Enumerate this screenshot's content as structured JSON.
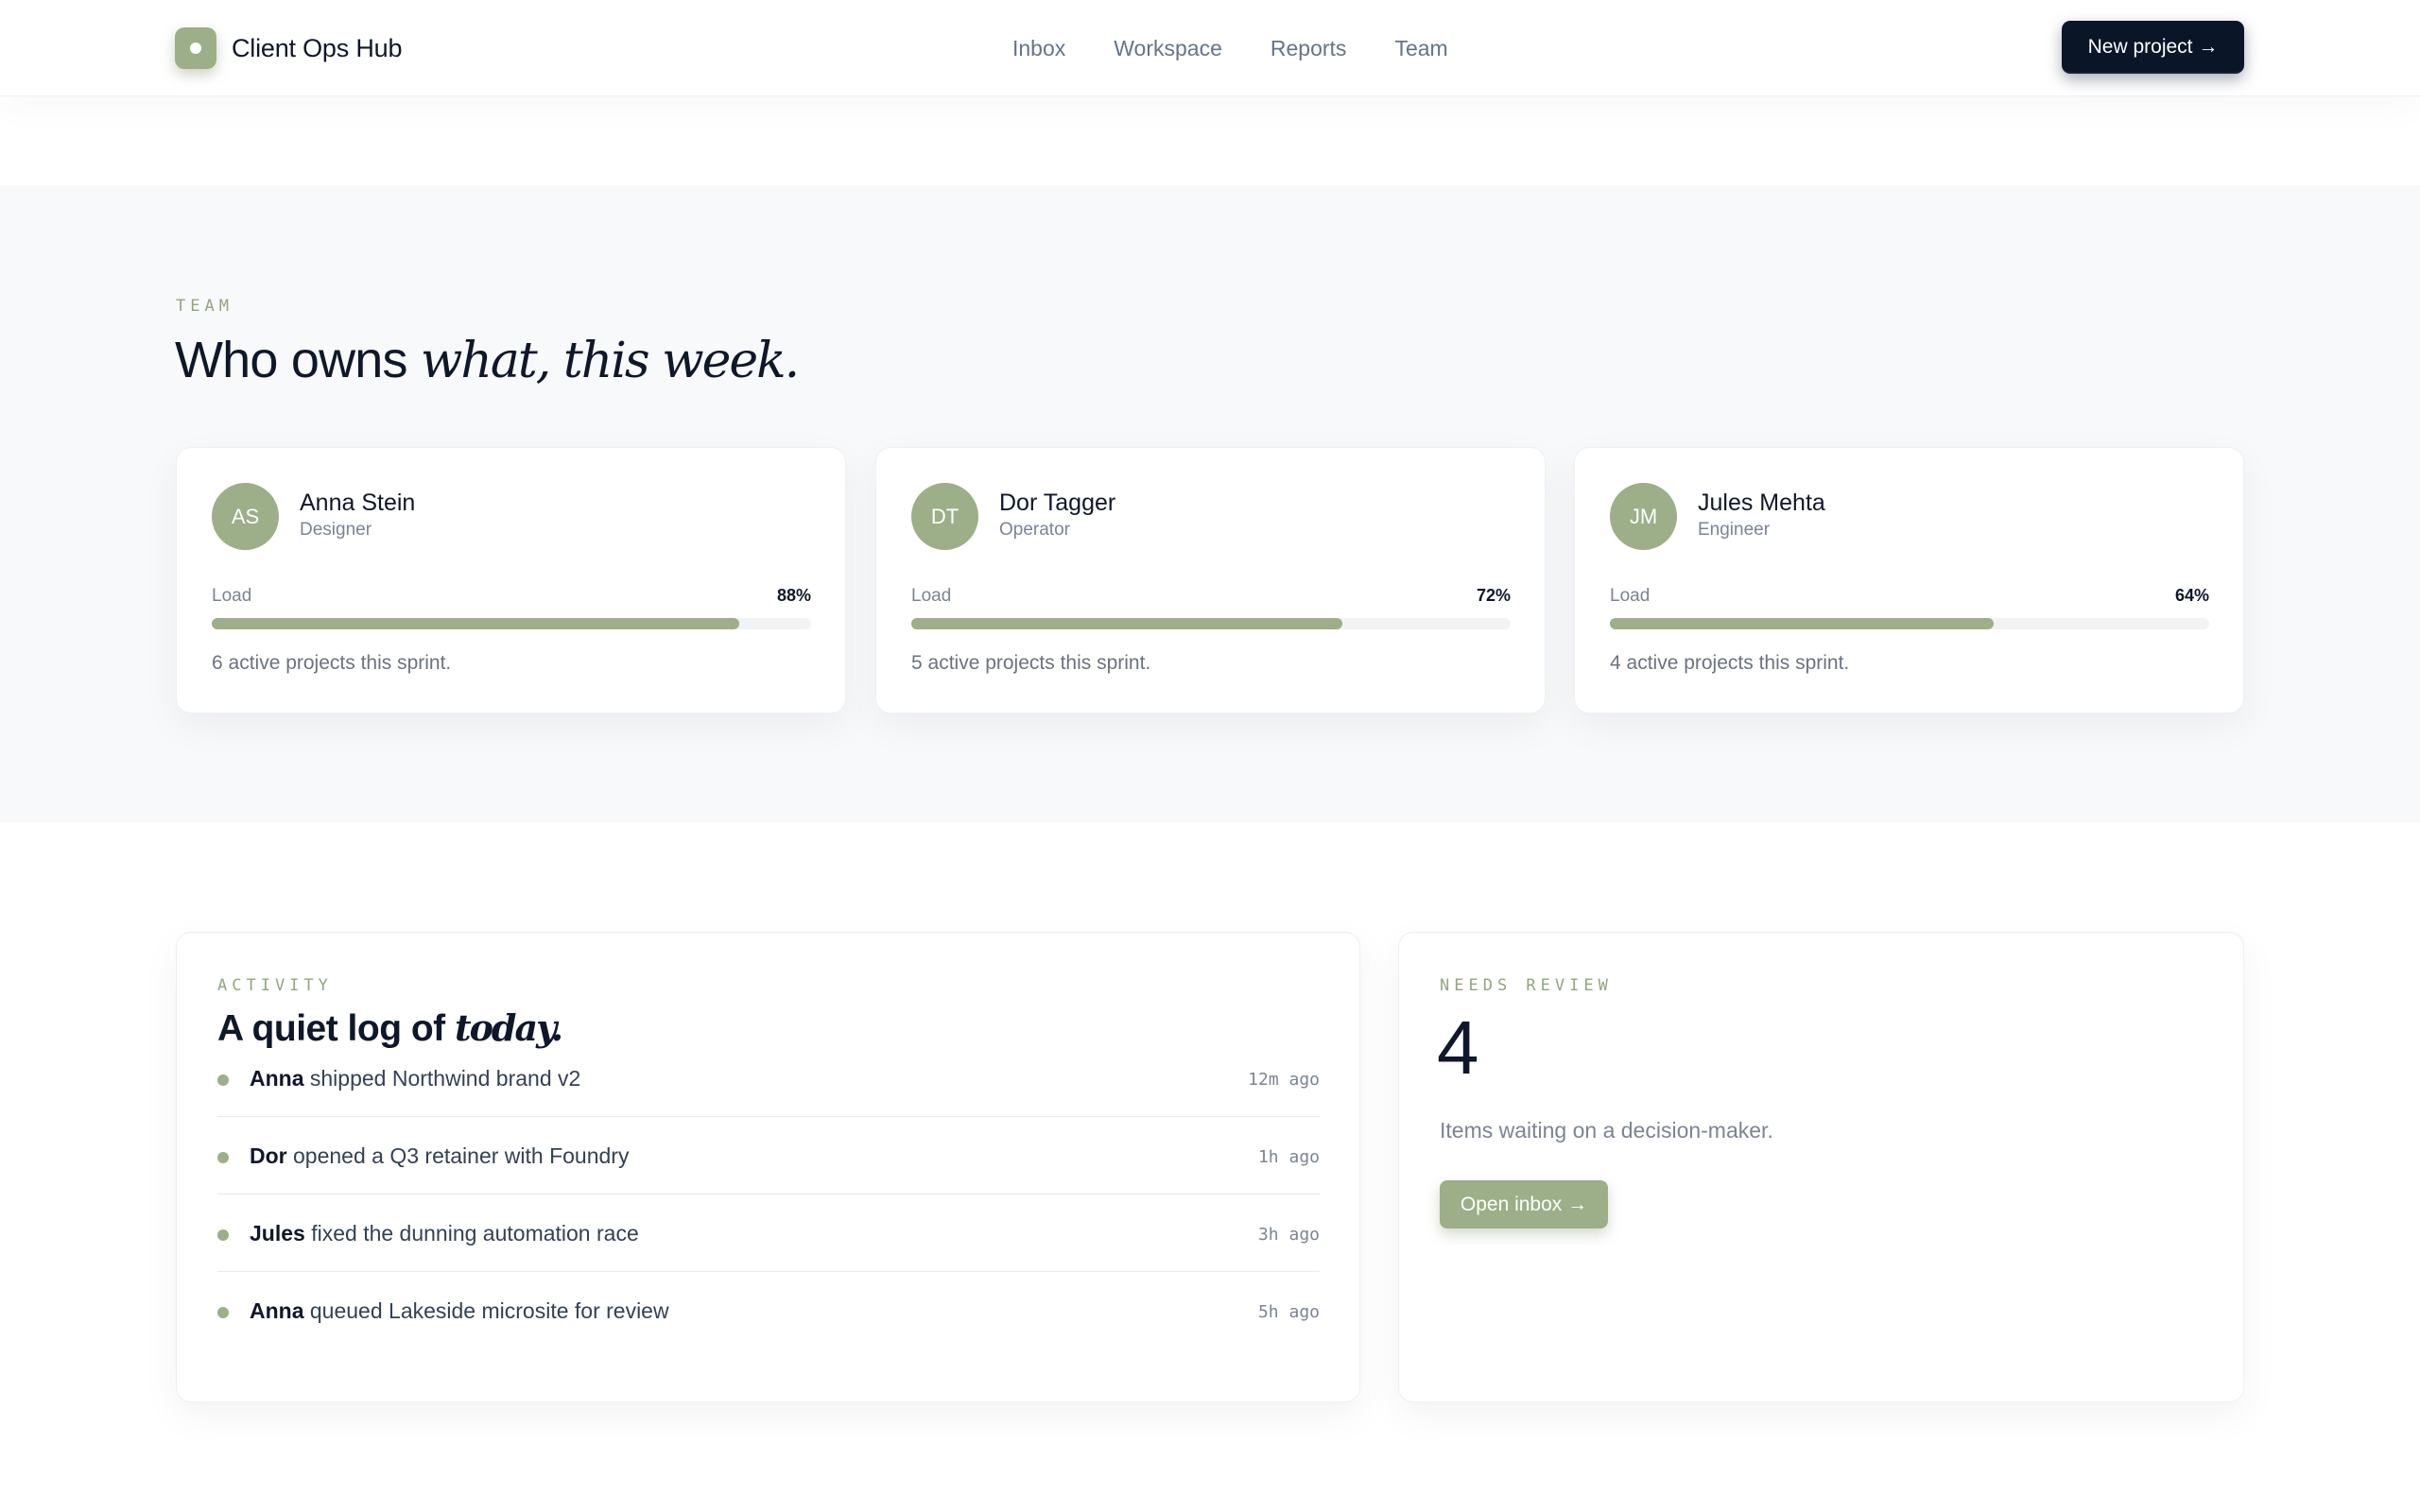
{
  "header": {
    "brand": "Client Ops Hub",
    "logo_icon": "dot-logo-icon",
    "nav": [
      "Inbox",
      "Workspace",
      "Reports",
      "Team"
    ],
    "cta": "New project →"
  },
  "team": {
    "eyebrow": "TEAM",
    "title_plain": "Who owns ",
    "title_italic": "what, this week.",
    "load_label": "Load",
    "members": [
      {
        "initials": "AS",
        "name": "Anna Stein",
        "role": "Designer",
        "load_pct": 88,
        "load_text": "88%",
        "note": "6 active projects this sprint."
      },
      {
        "initials": "DT",
        "name": "Dor Tagger",
        "role": "Operator",
        "load_pct": 72,
        "load_text": "72%",
        "note": "5 active projects this sprint."
      },
      {
        "initials": "JM",
        "name": "Jules Mehta",
        "role": "Engineer",
        "load_pct": 64,
        "load_text": "64%",
        "note": "4 active projects this sprint."
      }
    ]
  },
  "activity": {
    "eyebrow": "ACTIVITY",
    "title_plain": "A quiet log of ",
    "title_italic": "today.",
    "items": [
      {
        "who": "Anna",
        "what": " shipped Northwind brand v2",
        "time": "12m ago"
      },
      {
        "who": "Dor",
        "what": " opened a Q3 retainer with Foundry",
        "time": "1h ago"
      },
      {
        "who": "Jules",
        "what": " fixed the dunning automation race",
        "time": "3h ago"
      },
      {
        "who": "Anna",
        "what": " queued Lakeside microsite for review",
        "time": "5h ago"
      }
    ]
  },
  "review": {
    "eyebrow": "NEEDS REVIEW",
    "count": "4",
    "subtitle": "Items waiting on a decision-maker.",
    "button": "Open inbox →"
  },
  "colors": {
    "accent": "#9caf88",
    "ink": "#0f172a",
    "cta_bg": "#0b1528",
    "muted": "#7b8494",
    "band_bg": "#f8f9fa"
  }
}
